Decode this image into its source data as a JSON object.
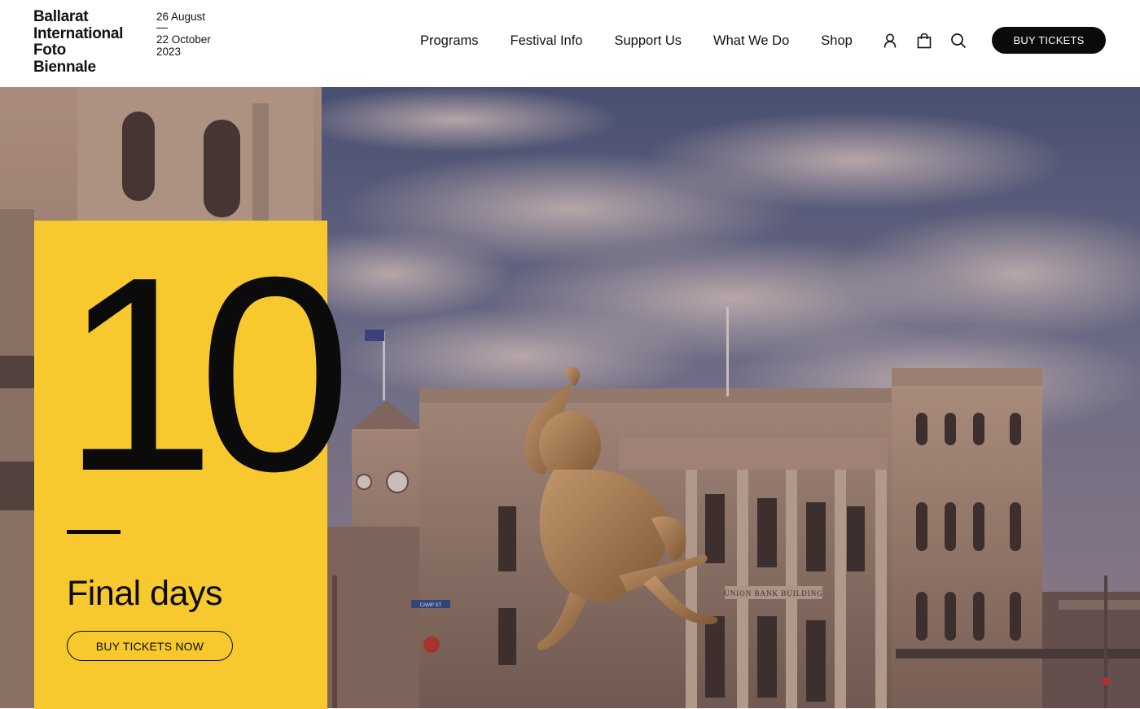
{
  "header": {
    "logo_lines": [
      "Ballarat",
      "International",
      "Foto",
      "Biennale"
    ],
    "dates": {
      "start": "26 August",
      "end_line1": "22 October",
      "end_line2": "2023"
    },
    "nav": [
      {
        "label": "Programs"
      },
      {
        "label": "Festival Info"
      },
      {
        "label": "Support Us"
      },
      {
        "label": "What We Do"
      },
      {
        "label": "Shop"
      }
    ],
    "icons": [
      "account-icon",
      "shopping-bag-icon",
      "search-icon"
    ],
    "buy_label": "BUY TICKETS"
  },
  "hero": {
    "sign_text": "UNION BANK BUILDING",
    "street_sign": "CAMP ST"
  },
  "promo": {
    "number": "10",
    "title": "Final days",
    "button_label": "BUY TICKETS NOW"
  },
  "colors": {
    "accent_yellow": "#f7c92e",
    "button_black": "#0b0b0b"
  }
}
